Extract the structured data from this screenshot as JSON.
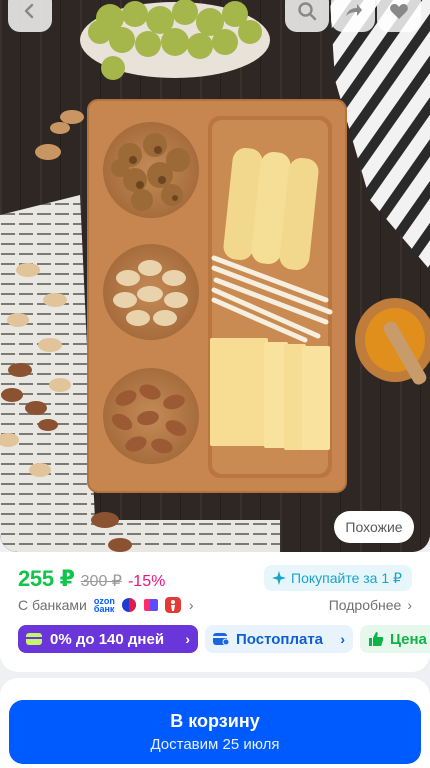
{
  "header": {
    "back_icon": "chevron-left-icon",
    "search_icon": "search-icon",
    "share_icon": "share-icon",
    "favorite_icon": "heart-icon"
  },
  "gallery": {
    "similar_label": "Похожие"
  },
  "pricing": {
    "price": "255 ₽",
    "old_price": "300 ₽",
    "discount": "-15%",
    "promo": "Покупайте за 1 ₽",
    "banks_label": "С банками",
    "ozon_bank_line1": "ozon",
    "ozon_bank_line2": "банк",
    "details_label": "Подробнее"
  },
  "pills": {
    "installment": "0% до 140 дней",
    "postpay": "Постоплата",
    "price_tag": "Цена"
  },
  "cart": {
    "title": "В корзину",
    "delivery": "Доставим 25 июля"
  },
  "colors": {
    "price_green": "#10c44c",
    "discount_pink": "#f1117e",
    "ozon_blue": "#005bff",
    "installment_purple": "#6a35d9"
  }
}
